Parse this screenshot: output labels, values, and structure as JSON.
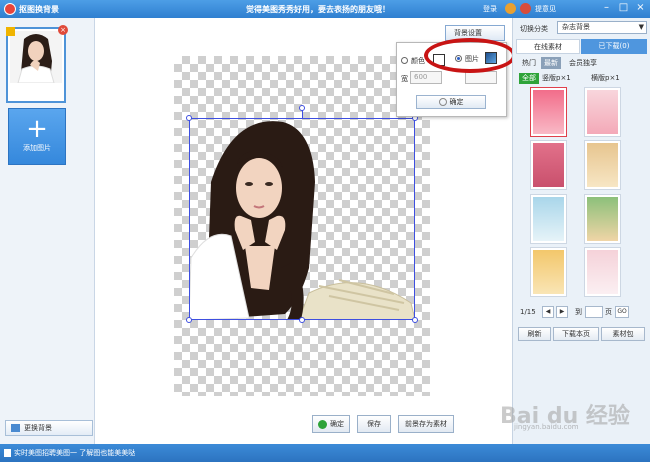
{
  "titlebar": {
    "app_title": "抠图换背景",
    "slogan": "觉得美图秀秀好用，要去表扬的朋友哦！",
    "login": "登录",
    "feedback": "提意见",
    "window_buttons": [
      "–",
      "□",
      "×"
    ]
  },
  "left_panel": {
    "add_picture": "添加图片",
    "change_background": "更换背景"
  },
  "background_popup": {
    "set_button": "背景设置",
    "option_color": "颜色",
    "option_picture": "图片",
    "selected": "图片",
    "width_label": "宽",
    "width_value": "600",
    "height_value": "",
    "confirm": "确定"
  },
  "bottom_buttons": {
    "ok": "确定",
    "save": "保存",
    "save_as_material": "前景存为素材"
  },
  "right_panel": {
    "category_label": "切换分类",
    "category_value": "杂志背景",
    "tabs": [
      "在线素材",
      "已下载(0)"
    ],
    "subtabs": [
      "热门",
      "最新",
      "会员独享"
    ],
    "filters": [
      "全部",
      "竖版",
      "横版"
    ],
    "filter_sizes": [
      "p×1",
      "p×1"
    ],
    "pager_text": "1/15",
    "pager_goto": "到",
    "pager_page": "页",
    "pager_go": "GO",
    "actions": [
      "刷新",
      "下载本页",
      "素材包"
    ]
  },
  "statusbar": {
    "text": "实时美图招聘美图一 了解图也能美美哒"
  },
  "watermark": {
    "logo": "Bai du 经验",
    "url": "jingyan.baidu.com"
  },
  "colors": {
    "titlebar": "#2f7fd0",
    "selection": "#3e4fe0",
    "annotation_ring": "#c81414",
    "accent_blue": "#3588dc"
  }
}
